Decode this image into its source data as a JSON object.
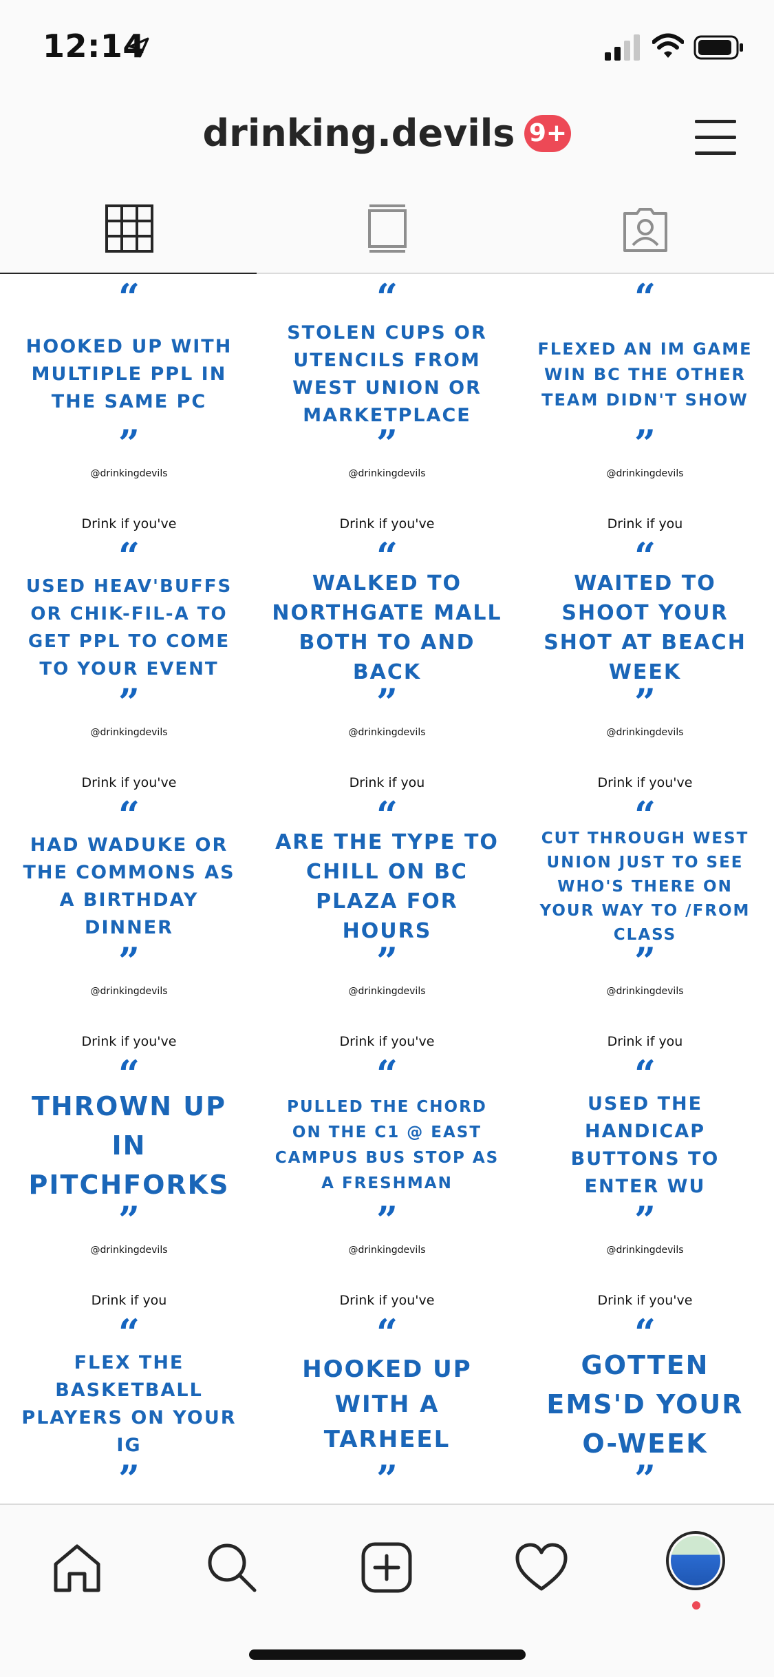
{
  "status_bar": {
    "time": "12:14"
  },
  "header": {
    "username": "drinking.devils",
    "notification_badge": "9+"
  },
  "tabs": [
    {
      "name": "grid",
      "icon": "grid-icon",
      "active": true
    },
    {
      "name": "igtv",
      "icon": "igtv-icon",
      "active": false
    },
    {
      "name": "tagged",
      "icon": "tagged-person-icon",
      "active": false
    }
  ],
  "posts": [
    {
      "drink": "",
      "text": "HOOKED UP WITH MULTIPLE PPL IN THE SAME PC",
      "handle": "@drinkingdevils"
    },
    {
      "drink": "",
      "text": "STOLEN CUPS OR UTENCILS FROM WEST UNION OR MARKETPLACE",
      "handle": "@drinkingdevils"
    },
    {
      "drink": "",
      "text": "FLEXED AN IM GAME WIN BC THE OTHER TEAM DIDN'T SHOW",
      "handle": "@drinkingdevils"
    },
    {
      "drink": "Drink if you've",
      "text": "USED HEAV'BUFFS OR CHIK-FIL-A TO GET PPL TO COME TO YOUR EVENT",
      "handle": "@drinkingdevils"
    },
    {
      "drink": "Drink if you've",
      "text": "WALKED TO NORTHGATE MALL BOTH TO AND BACK",
      "handle": "@drinkingdevils"
    },
    {
      "drink": "Drink if you",
      "text": "WAITED TO SHOOT YOUR SHOT AT BEACH WEEK",
      "handle": "@drinkingdevils"
    },
    {
      "drink": "Drink if you've",
      "text": "HAD WADUKE OR THE COMMONS AS A BIRTHDAY DINNER",
      "handle": "@drinkingdevils"
    },
    {
      "drink": "Drink if you",
      "text": "ARE THE TYPE TO CHILL ON BC PLAZA FOR HOURS",
      "handle": "@drinkingdevils"
    },
    {
      "drink": "Drink if you've",
      "text": "CUT THROUGH WEST UNION JUST TO SEE WHO'S THERE ON YOUR WAY TO /FROM CLASS",
      "handle": "@drinkingdevils"
    },
    {
      "drink": "Drink if you've",
      "text": "THROWN UP IN PITCHFORKS",
      "handle": "@drinkingdevils"
    },
    {
      "drink": "Drink if you've",
      "text": "PULLED THE CHORD ON THE C1 @ EAST CAMPUS BUS STOP AS A FRESHMAN",
      "handle": "@drinkingdevils"
    },
    {
      "drink": "Drink if you",
      "text": "USED THE HANDICAP BUTTONS TO ENTER WU",
      "handle": "@drinkingdevils"
    },
    {
      "drink": "Drink if you",
      "text": "FLEX THE BASKETBALL PLAYERS ON YOUR IG",
      "handle": ""
    },
    {
      "drink": "Drink if you've",
      "text": "HOOKED UP WITH A TARHEEL",
      "handle": ""
    },
    {
      "drink": "Drink if you've",
      "text": "GOTTEN EMS'D YOUR O-WEEK",
      "handle": ""
    }
  ],
  "bottom_nav": [
    {
      "name": "home",
      "icon": "home-icon"
    },
    {
      "name": "search",
      "icon": "search-icon"
    },
    {
      "name": "new-post",
      "icon": "add-post-icon"
    },
    {
      "name": "activity",
      "icon": "heart-icon"
    },
    {
      "name": "profile",
      "icon": "profile-avatar"
    }
  ],
  "colors": {
    "quote_blue": "#1a66b8",
    "badge_red": "#ed4956",
    "background": "#fafafa"
  }
}
